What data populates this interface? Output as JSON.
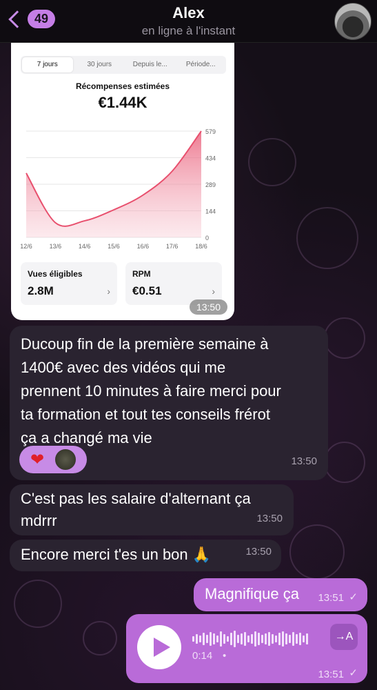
{
  "header": {
    "back_count": "49",
    "contact_name": "Alex",
    "status": "en ligne à l'instant"
  },
  "image_message": {
    "tabs": [
      "7 jours",
      "30 jours",
      "Depuis le...",
      "Période..."
    ],
    "chart_title": "Récompenses estimées",
    "total": "€1.44K",
    "stats": [
      {
        "label": "Vues éligibles",
        "value": "2.8M"
      },
      {
        "label": "RPM",
        "value": "€0.51"
      }
    ],
    "time": "13:50"
  },
  "chart_data": {
    "type": "area",
    "categories": [
      "12/6",
      "13/6",
      "14/6",
      "15/6",
      "16/6",
      "17/6",
      "18/6"
    ],
    "values": [
      350,
      80,
      90,
      150,
      230,
      360,
      579
    ],
    "y_ticks": [
      "0",
      "144",
      "289",
      "434",
      "579"
    ],
    "ylim": [
      0,
      579
    ],
    "color": "#e8506e"
  },
  "messages": [
    {
      "text_lines": [
        "Ducoup fin de la première semaine à",
        "1400€ avec des vidéos qui me",
        "prennent 10 minutes à faire merci pour",
        "ta formation et tout tes conseils frérot",
        "ça a changé ma vie"
      ],
      "time": "13:50",
      "reaction": "❤"
    },
    {
      "text_lines": [
        "C'est pas les salaire d'alternant ça",
        "mdrrr"
      ],
      "time": "13:50"
    },
    {
      "text": "Encore merci t'es un bon 🙏",
      "time": "13:50"
    }
  ],
  "outgoing": [
    {
      "text": "Magnifique ça",
      "time": "13:51",
      "check": "✓"
    },
    {
      "voice_duration": "0:14",
      "time": "13:51",
      "check": "✓",
      "transcribe_label": "→A"
    }
  ],
  "colors": {
    "accent": "#c78be6",
    "bubble_out": "#b96bd8",
    "bubble_in": "#2a2330"
  }
}
